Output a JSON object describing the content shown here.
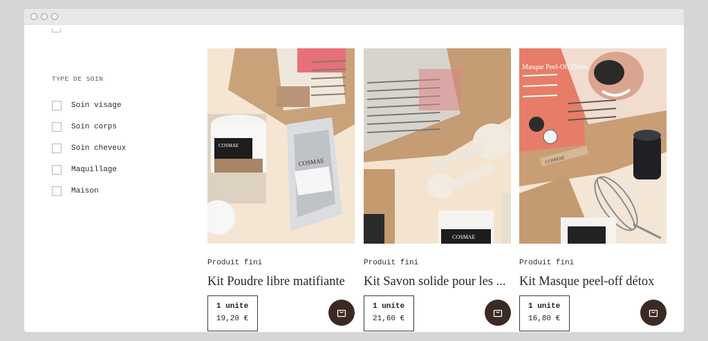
{
  "filters": {
    "section_title": "TYPE DE SOIN",
    "items": [
      {
        "label": "Soin visage"
      },
      {
        "label": "Soin corps"
      },
      {
        "label": "Soin cheveux"
      },
      {
        "label": "Maquillage"
      },
      {
        "label": "Maison"
      }
    ]
  },
  "products": [
    {
      "category": "Produit fini",
      "name": "Kit Poudre libre matifiante",
      "quantity": "1 unite",
      "price": "19,20 €",
      "image": "kit-poudre-libre-photo",
      "cart_icon": "shopping-bag-icon"
    },
    {
      "category": "Produit fini",
      "name": "Kit Savon solide pour les ...",
      "quantity": "1 unite",
      "price": "21,60 €",
      "image": "kit-savon-solide-photo",
      "cart_icon": "shopping-bag-icon"
    },
    {
      "category": "Produit fini",
      "name": "Kit Masque peel-off détox",
      "quantity": "1 unite",
      "price": "16,80 €",
      "image": "kit-masque-detox-photo",
      "cart_icon": "shopping-bag-icon"
    }
  ],
  "colors": {
    "cart_button": "#3a2a23",
    "text": "#2c2522",
    "page_background": "#d6d6d6"
  },
  "product_images": {
    "kit1_jar_label": "COSMAE",
    "kit1_pouch_label": "COSMAE",
    "kit2_jar_label": "COSMAE",
    "kit3_box_title": "Masque Peel-Off Détox",
    "kit3_box_brand": "COSMAE"
  }
}
